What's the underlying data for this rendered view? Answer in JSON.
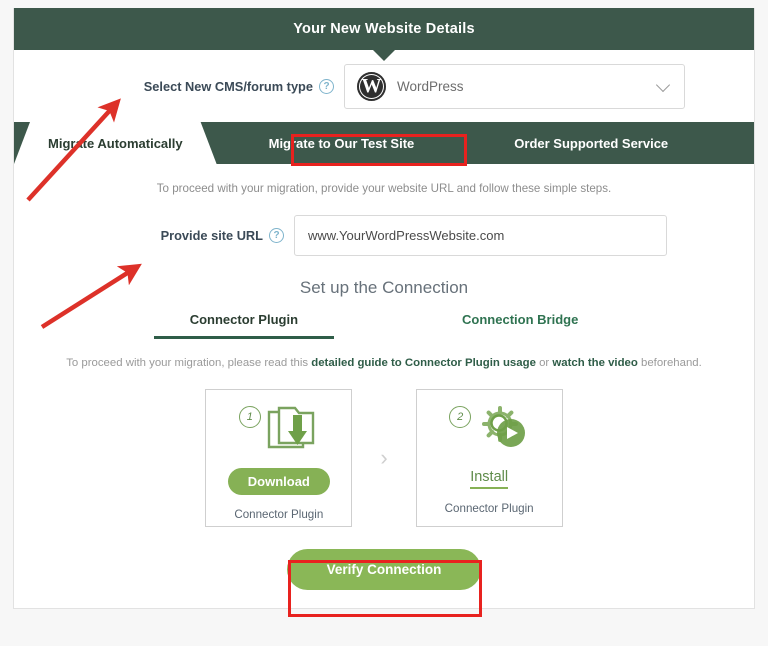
{
  "header": {
    "title": "Your New Website Details"
  },
  "cms_row": {
    "label": "Select New CMS/forum type",
    "help_icon": "question-mark-icon",
    "selected_value": "WordPress",
    "logo_glyph": "W",
    "chevron_icon": "chevron-down-icon"
  },
  "tabs": [
    {
      "label": "Migrate Automatically",
      "active": true
    },
    {
      "label": "Migrate to Our Test Site",
      "active": false,
      "highlighted": true
    },
    {
      "label": "Order Supported Service",
      "active": false
    }
  ],
  "body": {
    "intro": "To proceed with your migration, provide your website URL and follow these simple steps.",
    "url_label": "Provide site URL",
    "url_help_icon": "question-mark-icon",
    "url_value": "www.YourWordPressWebsite.com",
    "url_placeholder": "www.YourWordPressWebsite.com",
    "section_title": "Set up the Connection",
    "subtabs": [
      {
        "label": "Connector Plugin",
        "active": true
      },
      {
        "label": "Connection Bridge",
        "active": false
      }
    ],
    "guide": {
      "prefix": "To proceed with your migration, please read this ",
      "link1": "detailed guide to Connector Plugin usage",
      "middle": " or ",
      "link2": "watch the video",
      "suffix": " beforehand."
    },
    "steps": [
      {
        "number": "1",
        "icon": "folder-download-icon",
        "action_label": "Download",
        "caption": "Connector Plugin"
      },
      {
        "number": "2",
        "icon": "gear-play-icon",
        "action_label": "Install",
        "caption": "Connector Plugin"
      }
    ],
    "step_separator_icon": "chevron-right-icon",
    "verify_button": "Verify Connection"
  },
  "annotations": {
    "arrow_1": "red-arrow-pointing-to-cms-label",
    "arrow_2": "red-arrow-pointing-to-site-url-label",
    "highlight_tab": "red-box-around-migrate-to-test-site-tab",
    "highlight_verify": "red-box-around-verify-connection-button"
  },
  "colors": {
    "header_green": "#3d584b",
    "accent_green": "#8ab757",
    "link_green": "#2f5d48",
    "annotation_red": "#e8221f"
  }
}
